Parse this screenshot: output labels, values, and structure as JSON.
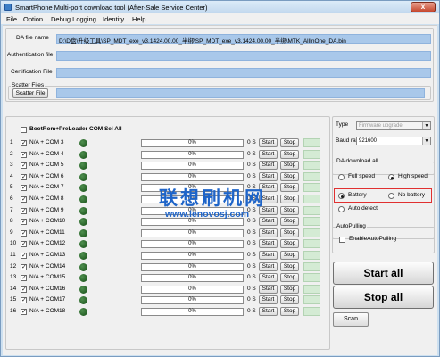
{
  "window": {
    "title": "SmartPhone Multi-port download tool (After-Sale Service Center)",
    "close_label": "x"
  },
  "menu": [
    "File",
    "Option",
    "Debug Logging",
    "Identity",
    "Help"
  ],
  "files": {
    "da_label": "DA file name",
    "da_value": "D:\\D盘\\升级工具\\SP_MDT_exe_v3.1424.00.00_半绑\\SP_MDT_exe_v3.1424.00.00_半绑\\MTK_AllInOne_DA.bin",
    "auth_label": "Authentication file",
    "auth_value": "",
    "cert_label": "Certification File",
    "cert_value": "",
    "scatter_group_label": "Scatter Files",
    "scatter_button": "Scatter File",
    "scatter_value": ""
  },
  "bootrom_label": "BootRom+PreLoader COM Sel All",
  "ports": [
    {
      "num": "1",
      "port": "N/A + COM 3",
      "progress": "0%",
      "secs": "0 S"
    },
    {
      "num": "2",
      "port": "N/A + COM 4",
      "progress": "0%",
      "secs": "0 S"
    },
    {
      "num": "3",
      "port": "N/A + COM 5",
      "progress": "0%",
      "secs": "0 S"
    },
    {
      "num": "4",
      "port": "N/A + COM 6",
      "progress": "0%",
      "secs": "0 S"
    },
    {
      "num": "5",
      "port": "N/A + COM 7",
      "progress": "0%",
      "secs": "0 S"
    },
    {
      "num": "6",
      "port": "N/A + COM 8",
      "progress": "0%",
      "secs": "0 S"
    },
    {
      "num": "7",
      "port": "N/A + COM 9",
      "progress": "0%",
      "secs": "0 S"
    },
    {
      "num": "8",
      "port": "N/A + COM10",
      "progress": "0%",
      "secs": "0 S"
    },
    {
      "num": "9",
      "port": "N/A + COM11",
      "progress": "0%",
      "secs": "0 S"
    },
    {
      "num": "10",
      "port": "N/A + COM12",
      "progress": "0%",
      "secs": "0 S"
    },
    {
      "num": "11",
      "port": "N/A + COM13",
      "progress": "0%",
      "secs": "0 S"
    },
    {
      "num": "12",
      "port": "N/A + COM14",
      "progress": "0%",
      "secs": "0 S"
    },
    {
      "num": "13",
      "port": "N/A + COM15",
      "progress": "0%",
      "secs": "0 S"
    },
    {
      "num": "14",
      "port": "N/A + COM16",
      "progress": "0%",
      "secs": "0 S"
    },
    {
      "num": "15",
      "port": "N/A + COM17",
      "progress": "0%",
      "secs": "0 S"
    },
    {
      "num": "16",
      "port": "N/A + COM18",
      "progress": "0%",
      "secs": "0 S"
    }
  ],
  "row_buttons": {
    "start": "Start",
    "stop": "Stop"
  },
  "settings": {
    "type_label": "Type",
    "type_value": "Firmware upgrade",
    "baud_label": "Baud rate",
    "baud_value": "921600",
    "da_download_label": "DA download all",
    "full_speed": "Full speed",
    "high_speed": "High speed",
    "battery": "Battery",
    "no_battery": "No battery",
    "auto_detect": "Auto detect",
    "autopulling_label": "AutoPulling",
    "enable_autopulling": "EnableAutoPulling"
  },
  "actions": {
    "start_all": "Start all",
    "stop_all": "Stop all",
    "scan": "Scan"
  },
  "watermark": {
    "brand": "联想刷机网",
    "url": "www.lenovosj.com"
  },
  "colors": {
    "field_bg": "#a9c8ea",
    "led_green": "#1f5f1f",
    "watermark": "#1e64c8",
    "highlight": "#e03030"
  }
}
